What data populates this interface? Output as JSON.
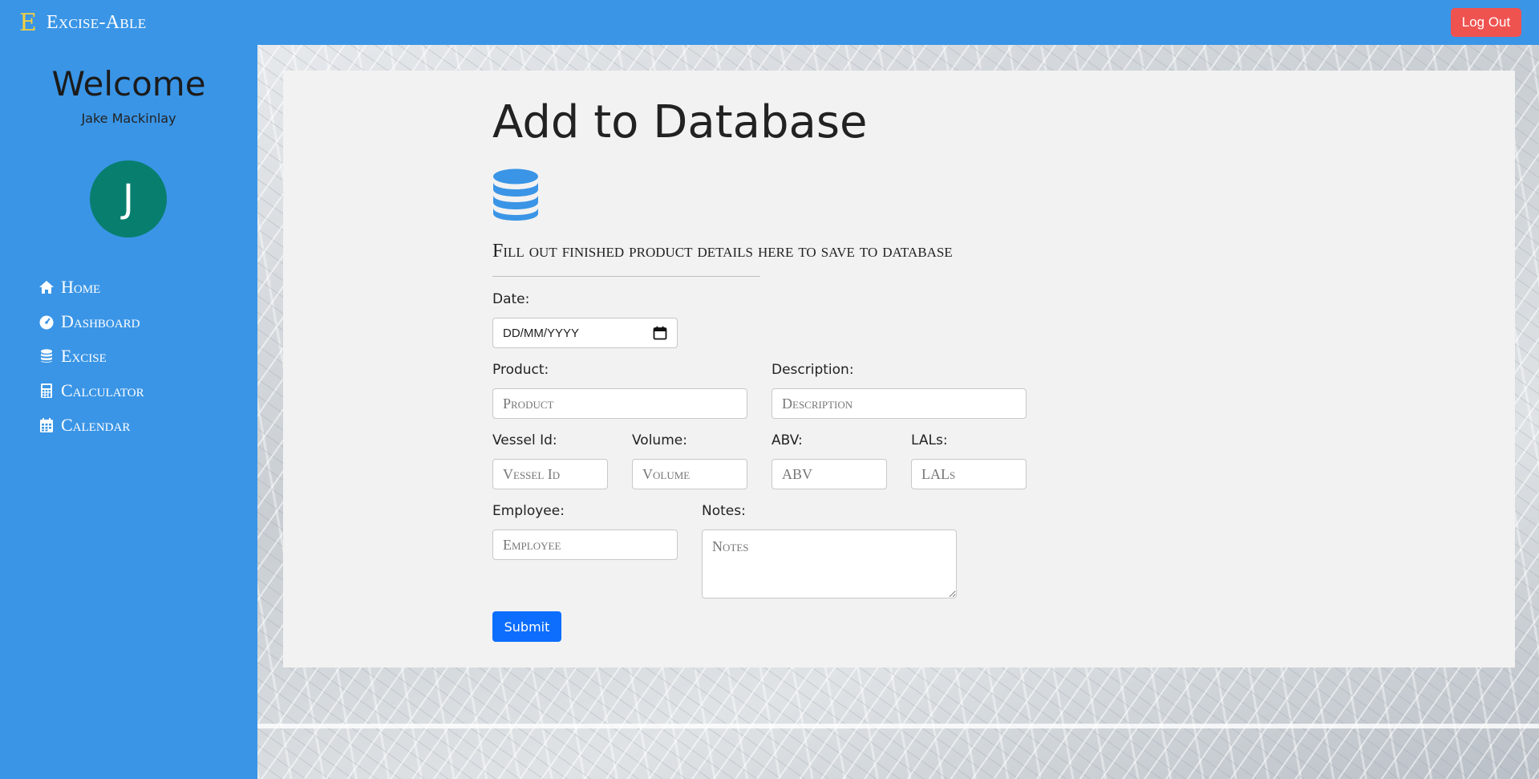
{
  "app": {
    "logo_letter": "E",
    "name": "Excise-Able",
    "logout_label": "Log Out"
  },
  "sidebar": {
    "welcome": "Welcome",
    "user_name": "Jake Mackinlay",
    "avatar_initial": "J",
    "items": [
      {
        "label": "Home",
        "icon": "house-icon"
      },
      {
        "label": "Dashboard",
        "icon": "gauge-icon"
      },
      {
        "label": "Excise",
        "icon": "database-icon"
      },
      {
        "label": "Calculator",
        "icon": "calculator-icon"
      },
      {
        "label": "Calendar",
        "icon": "calendar-icon"
      }
    ]
  },
  "main": {
    "title": "Add to Database",
    "icon": "database-icon",
    "subtitle": "Fill out finished product details here to save to database",
    "form": {
      "date_label": "Date:",
      "date_value": "DD/MM/YYYY",
      "product_label": "Product:",
      "product_placeholder": "Product",
      "description_label": "Description:",
      "description_placeholder": "Description",
      "vessel_label": "Vessel Id:",
      "vessel_placeholder": "Vessel Id",
      "volume_label": "Volume:",
      "volume_placeholder": "Volume",
      "abv_label": "ABV:",
      "abv_placeholder": "ABV",
      "lals_label": "LALs:",
      "lals_placeholder": "LALs",
      "employee_label": "Employee:",
      "employee_placeholder": "Employee",
      "notes_label": "Notes:",
      "notes_placeholder": "Notes",
      "submit_label": "Submit"
    }
  },
  "colors": {
    "primary_blue": "#3a95e6",
    "logout_red": "#ef5350",
    "avatar_teal": "#087e6f",
    "submit_blue": "#0d6efd",
    "logo_yellow": "#f4d03f",
    "panel_bg": "#f2f2f2"
  }
}
